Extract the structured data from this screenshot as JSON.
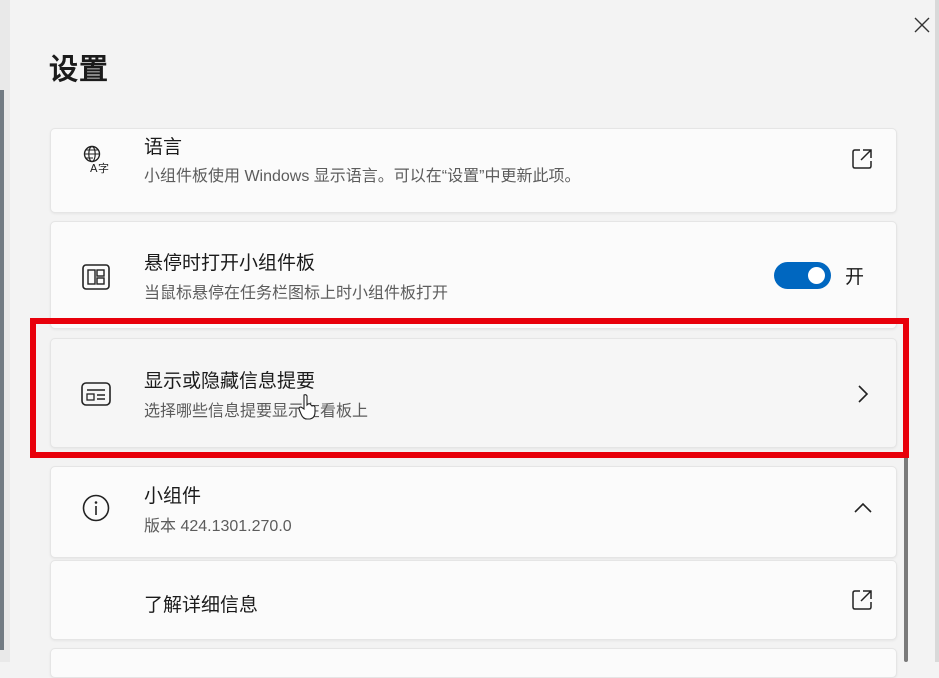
{
  "window": {
    "title": "设置",
    "close_icon": "close-icon"
  },
  "colors": {
    "toggle_on": "#0067c0",
    "highlight": "#e8000b"
  },
  "settings": [
    {
      "id": "language",
      "icon": "language-icon",
      "title": "语言",
      "description": "小组件板使用 Windows 显示语言。可以在“设置”中更新此项。",
      "action_icon": "external-link-icon"
    },
    {
      "id": "hover-open",
      "icon": "widgets-board-icon",
      "title": "悬停时打开小组件板",
      "description": "当鼠标悬停在任务栏图标上时小组件板打开",
      "toggle": {
        "state": "on",
        "label": "开"
      }
    },
    {
      "id": "feeds",
      "icon": "news-feed-icon",
      "title": "显示或隐藏信息提要",
      "description": "选择哪些信息提要显示在看板上",
      "action_icon": "chevron-right-icon",
      "highlighted": true
    },
    {
      "id": "widgets",
      "icon": "info-icon",
      "title": "小组件",
      "description": "版本 424.1301.270.0",
      "action_icon": "chevron-up-icon"
    },
    {
      "id": "learn-more",
      "title": "了解详细信息",
      "action_icon": "external-link-icon"
    }
  ]
}
